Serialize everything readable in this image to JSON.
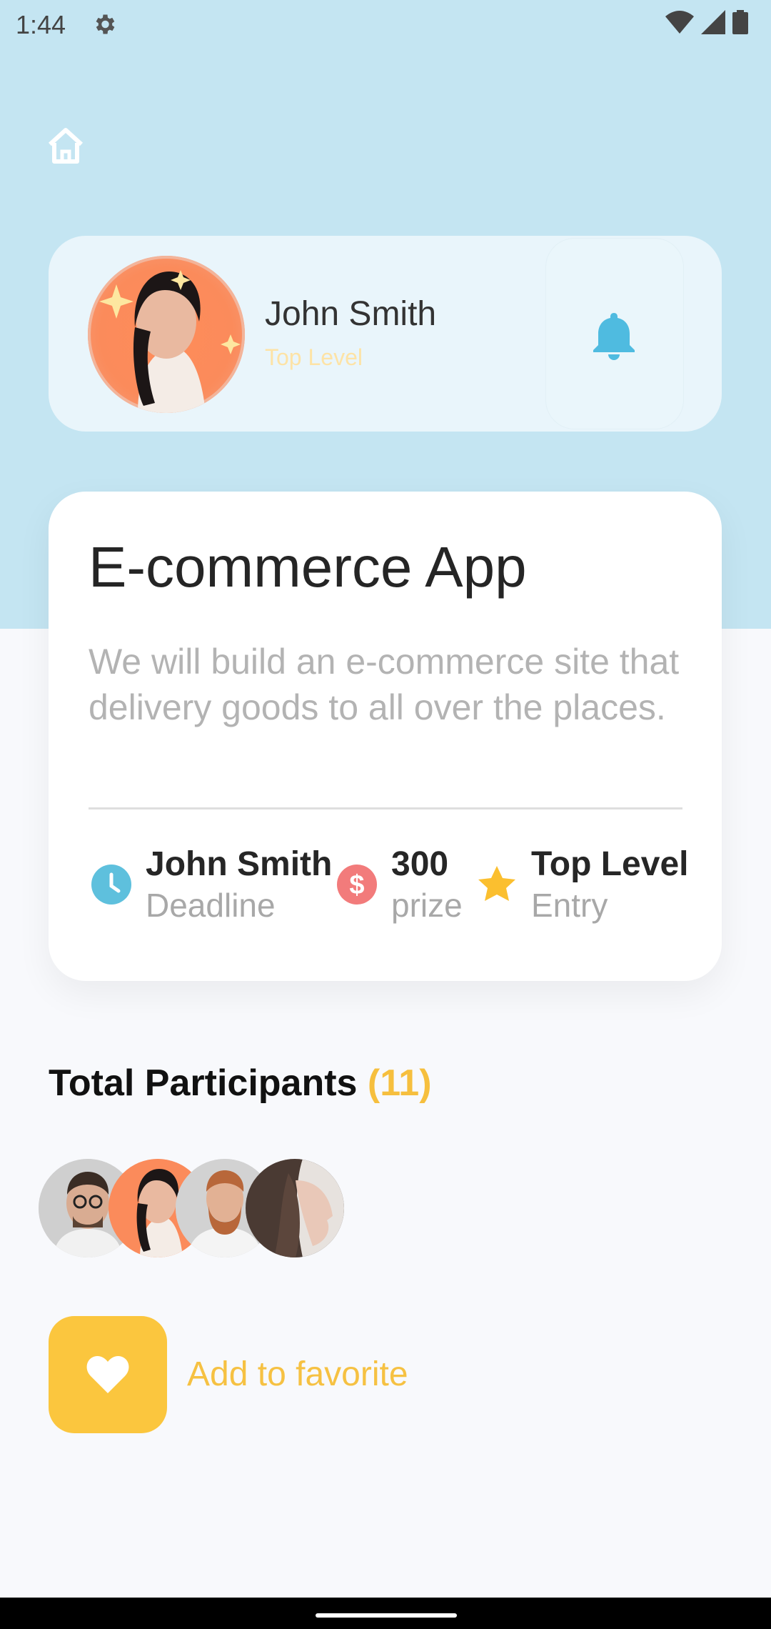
{
  "status_bar": {
    "time": "1:44"
  },
  "profile": {
    "name": "John Smith",
    "level": "Top Level"
  },
  "project": {
    "title": "E-commerce App",
    "description": "We will build an e-commerce site that delivery goods to all over the places.",
    "stats": [
      {
        "icon": "clock-icon",
        "value": "John Smith",
        "label": "Deadline",
        "color": "#5ec0dd"
      },
      {
        "icon": "dollar-icon",
        "value": "300",
        "label": "prize",
        "color": "#f27b7b"
      },
      {
        "icon": "star-icon",
        "value": "Top Level",
        "label": "Entry",
        "color": "#fbbf2f"
      }
    ]
  },
  "participants": {
    "title": "Total Participants",
    "count": "(11)"
  },
  "favorite": {
    "label": "Add to favorite"
  },
  "colors": {
    "header_bg": "#c4e5f2",
    "accent_yellow": "#fbc63e",
    "bell_blue": "#4fbbe0"
  }
}
